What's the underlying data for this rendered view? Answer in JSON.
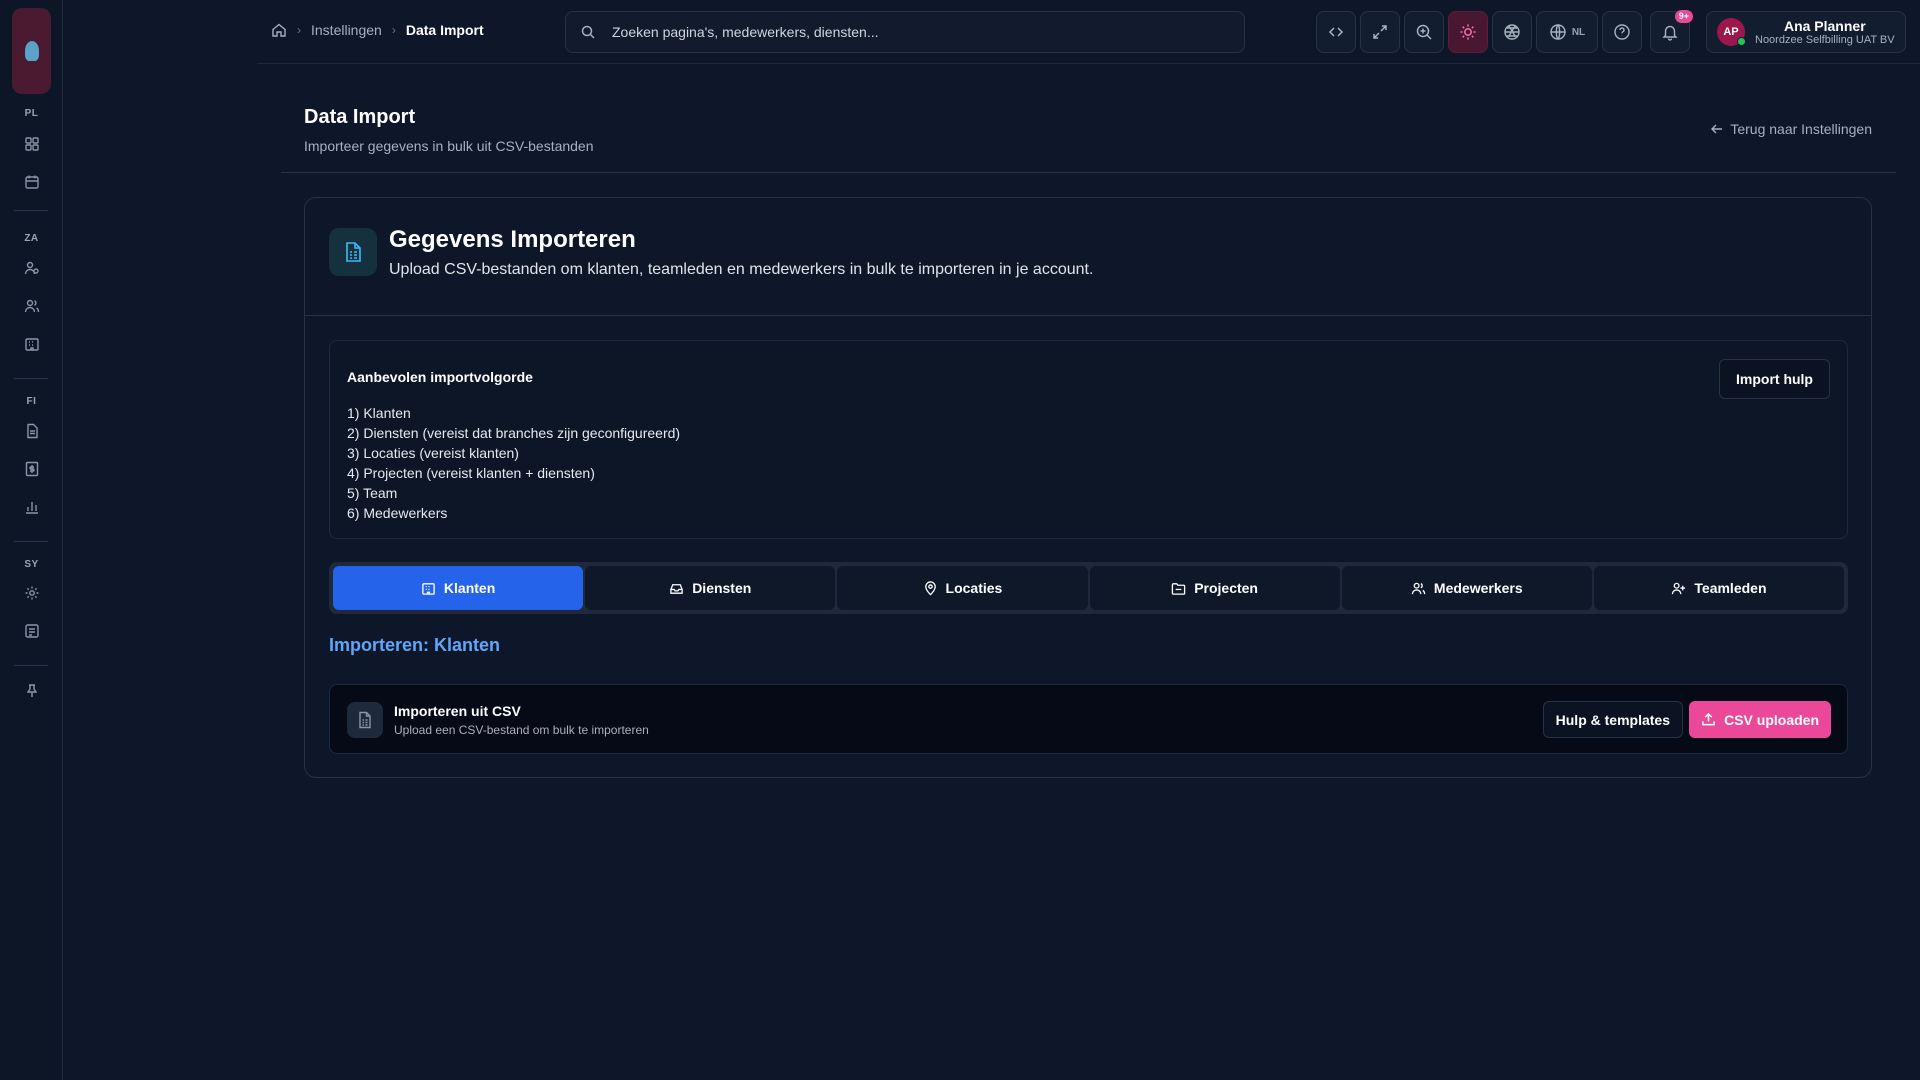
{
  "sidebar": {
    "logo_icon": "app-logo-icon",
    "sections": [
      {
        "label": "PL",
        "items": [
          "dashboard-icon",
          "calendar-icon"
        ]
      },
      {
        "label": "ZA",
        "items": [
          "contacts-icon",
          "users-icon",
          "building-icon"
        ]
      },
      {
        "label": "FI",
        "items": [
          "document-icon",
          "dollar-icon",
          "chart-icon"
        ]
      },
      {
        "label": "SY",
        "items": [
          "gear-icon",
          "import-icon"
        ]
      }
    ],
    "bottom_icon": "pin-icon"
  },
  "breadcrumb": {
    "home_icon": "home-icon",
    "items": [
      "Instellingen",
      "Data Import"
    ]
  },
  "search": {
    "placeholder": "Zoeken pagina's, medewerkers, diensten..."
  },
  "toolbar": {
    "language": "NL",
    "notification_badge": "9+"
  },
  "user": {
    "initials": "AP",
    "name": "Ana Planner",
    "org": "Noordzee Selfbilling UAT BV"
  },
  "page": {
    "title": "Data Import",
    "subtitle": "Importeer gegevens in bulk uit CSV-bestanden",
    "back_link": "Terug naar Instellingen"
  },
  "card": {
    "title": "Gegevens Importeren",
    "description": "Upload CSV-bestanden om klanten, teamleden en medewerkers in bulk te importeren in je account."
  },
  "order": {
    "title": "Aanbevolen importvolgorde",
    "help_button": "Import hulp",
    "items": [
      "1) Klanten",
      "2) Diensten (vereist dat branches zijn geconfigureerd)",
      "3) Locaties (vereist klanten)",
      "4) Projecten (vereist klanten + diensten)",
      "5) Team",
      "6) Medewerkers"
    ]
  },
  "tabs": [
    {
      "label": "Klanten",
      "icon": "building-icon",
      "active": true
    },
    {
      "label": "Diensten",
      "icon": "inbox-icon",
      "active": false
    },
    {
      "label": "Locaties",
      "icon": "map-pin-icon",
      "active": false
    },
    {
      "label": "Projecten",
      "icon": "folder-icon",
      "active": false
    },
    {
      "label": "Medewerkers",
      "icon": "users-icon",
      "active": false
    },
    {
      "label": "Teamleden",
      "icon": "user-plus-icon",
      "active": false
    }
  ],
  "import": {
    "heading": "Importeren: Klanten",
    "row_title": "Importeren uit CSV",
    "row_subtitle": "Upload een CSV-bestand om bulk te importeren",
    "help_templates": "Hulp & templates",
    "upload": "CSV uploaden"
  },
  "colors": {
    "background": "#0e1729",
    "accent_blue": "#2563eb",
    "accent_pink": "#ec4899",
    "heading_blue": "#60a5fa"
  }
}
